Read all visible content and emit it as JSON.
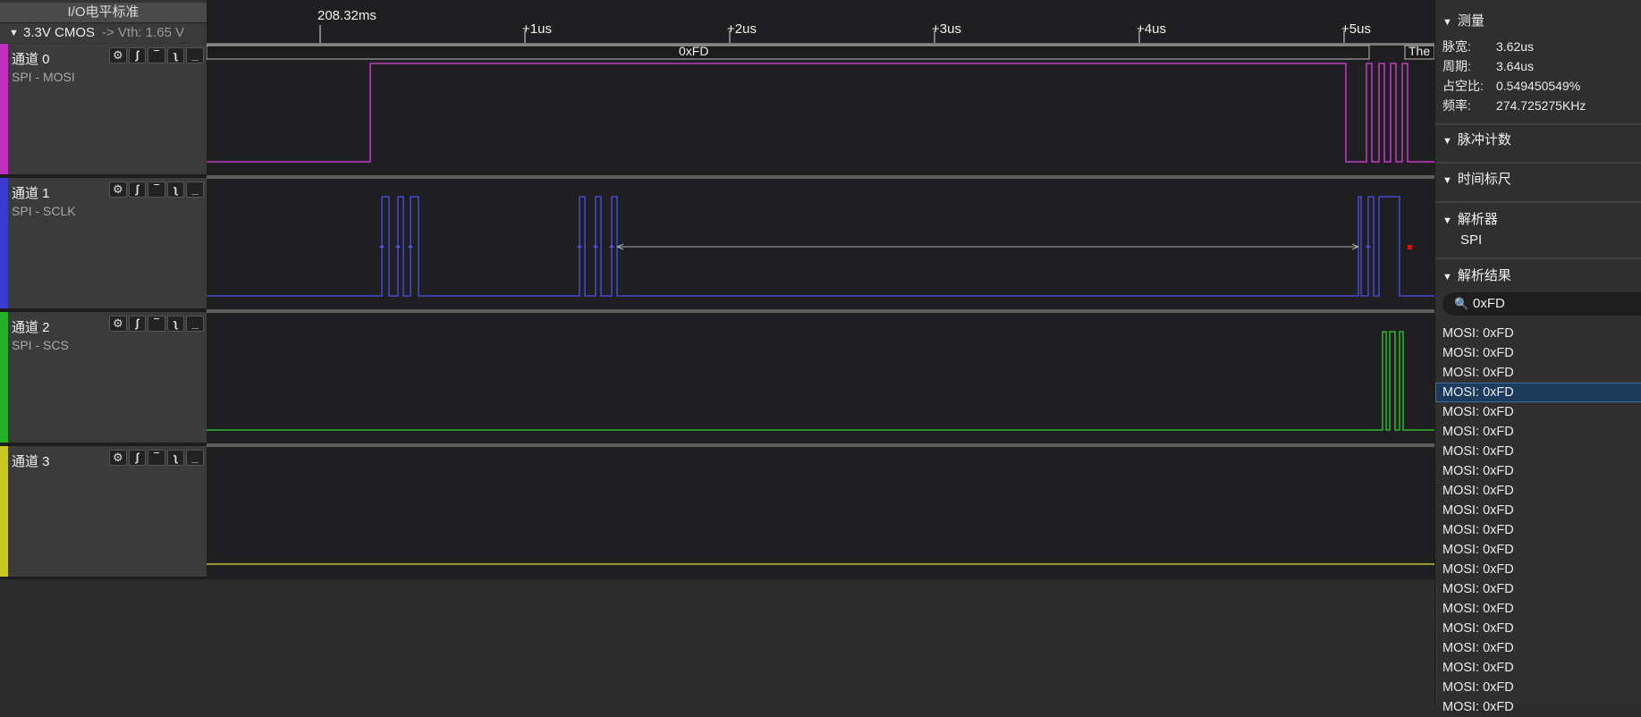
{
  "io": {
    "title": "I/O电平标准",
    "standard": "3.3V CMOS",
    "vth": "-> Vth: 1.65 V"
  },
  "timeline": {
    "cursor": "208.32ms",
    "ticks": [
      "+1us",
      "+2us",
      "+3us",
      "+4us",
      "+5us"
    ]
  },
  "decode": {
    "byte_label": "0xFD",
    "truncated_label": "The"
  },
  "channels": [
    {
      "name": "通道 0",
      "sub": "SPI - MOSI",
      "color": "#e040e0"
    },
    {
      "name": "通道 1",
      "sub": "SPI - SCLK",
      "color": "#4a50f0"
    },
    {
      "name": "通道 2",
      "sub": "SPI - SCS",
      "color": "#30d030"
    },
    {
      "name": "通道 3",
      "sub": "",
      "color": "#e0e030"
    }
  ],
  "channel_controls": {
    "gear": "⚙",
    "rise": "ʃ",
    "high": "‾",
    "fall": "ʅ",
    "low": "_"
  },
  "icons": {
    "channel_settings": "gear-icon",
    "search": "search-icon",
    "collapse": "triangle-down-icon"
  },
  "panel": {
    "measure_title": "测量",
    "measurements": [
      {
        "k": "脉宽:",
        "v": "3.62us"
      },
      {
        "k": "周期:",
        "v": "3.64us"
      },
      {
        "k": "占空比:",
        "v": "0.549450549%"
      },
      {
        "k": "频率:",
        "v": "274.725275KHz"
      }
    ],
    "pulse_count": "脉冲计数",
    "time_ruler": "时间标尺",
    "analyzer": "解析器",
    "analyzer_item": "SPI",
    "results_title": "解析结果",
    "search_value": "0xFD",
    "results": [
      "MOSI: 0xFD",
      "MOSI: 0xFD",
      "MOSI: 0xFD",
      "MOSI: 0xFD",
      "MOSI: 0xFD",
      "MOSI: 0xFD",
      "MOSI: 0xFD",
      "MOSI: 0xFD",
      "MOSI: 0xFD",
      "MOSI: 0xFD",
      "MOSI: 0xFD",
      "MOSI: 0xFD",
      "MOSI: 0xFD",
      "MOSI: 0xFD",
      "MOSI: 0xFD",
      "MOSI: 0xFD",
      "MOSI: 0xFD",
      "MOSI: 0xFD",
      "MOSI: 0xFD",
      "MOSI: 0xFD"
    ],
    "selected_result": 3
  }
}
